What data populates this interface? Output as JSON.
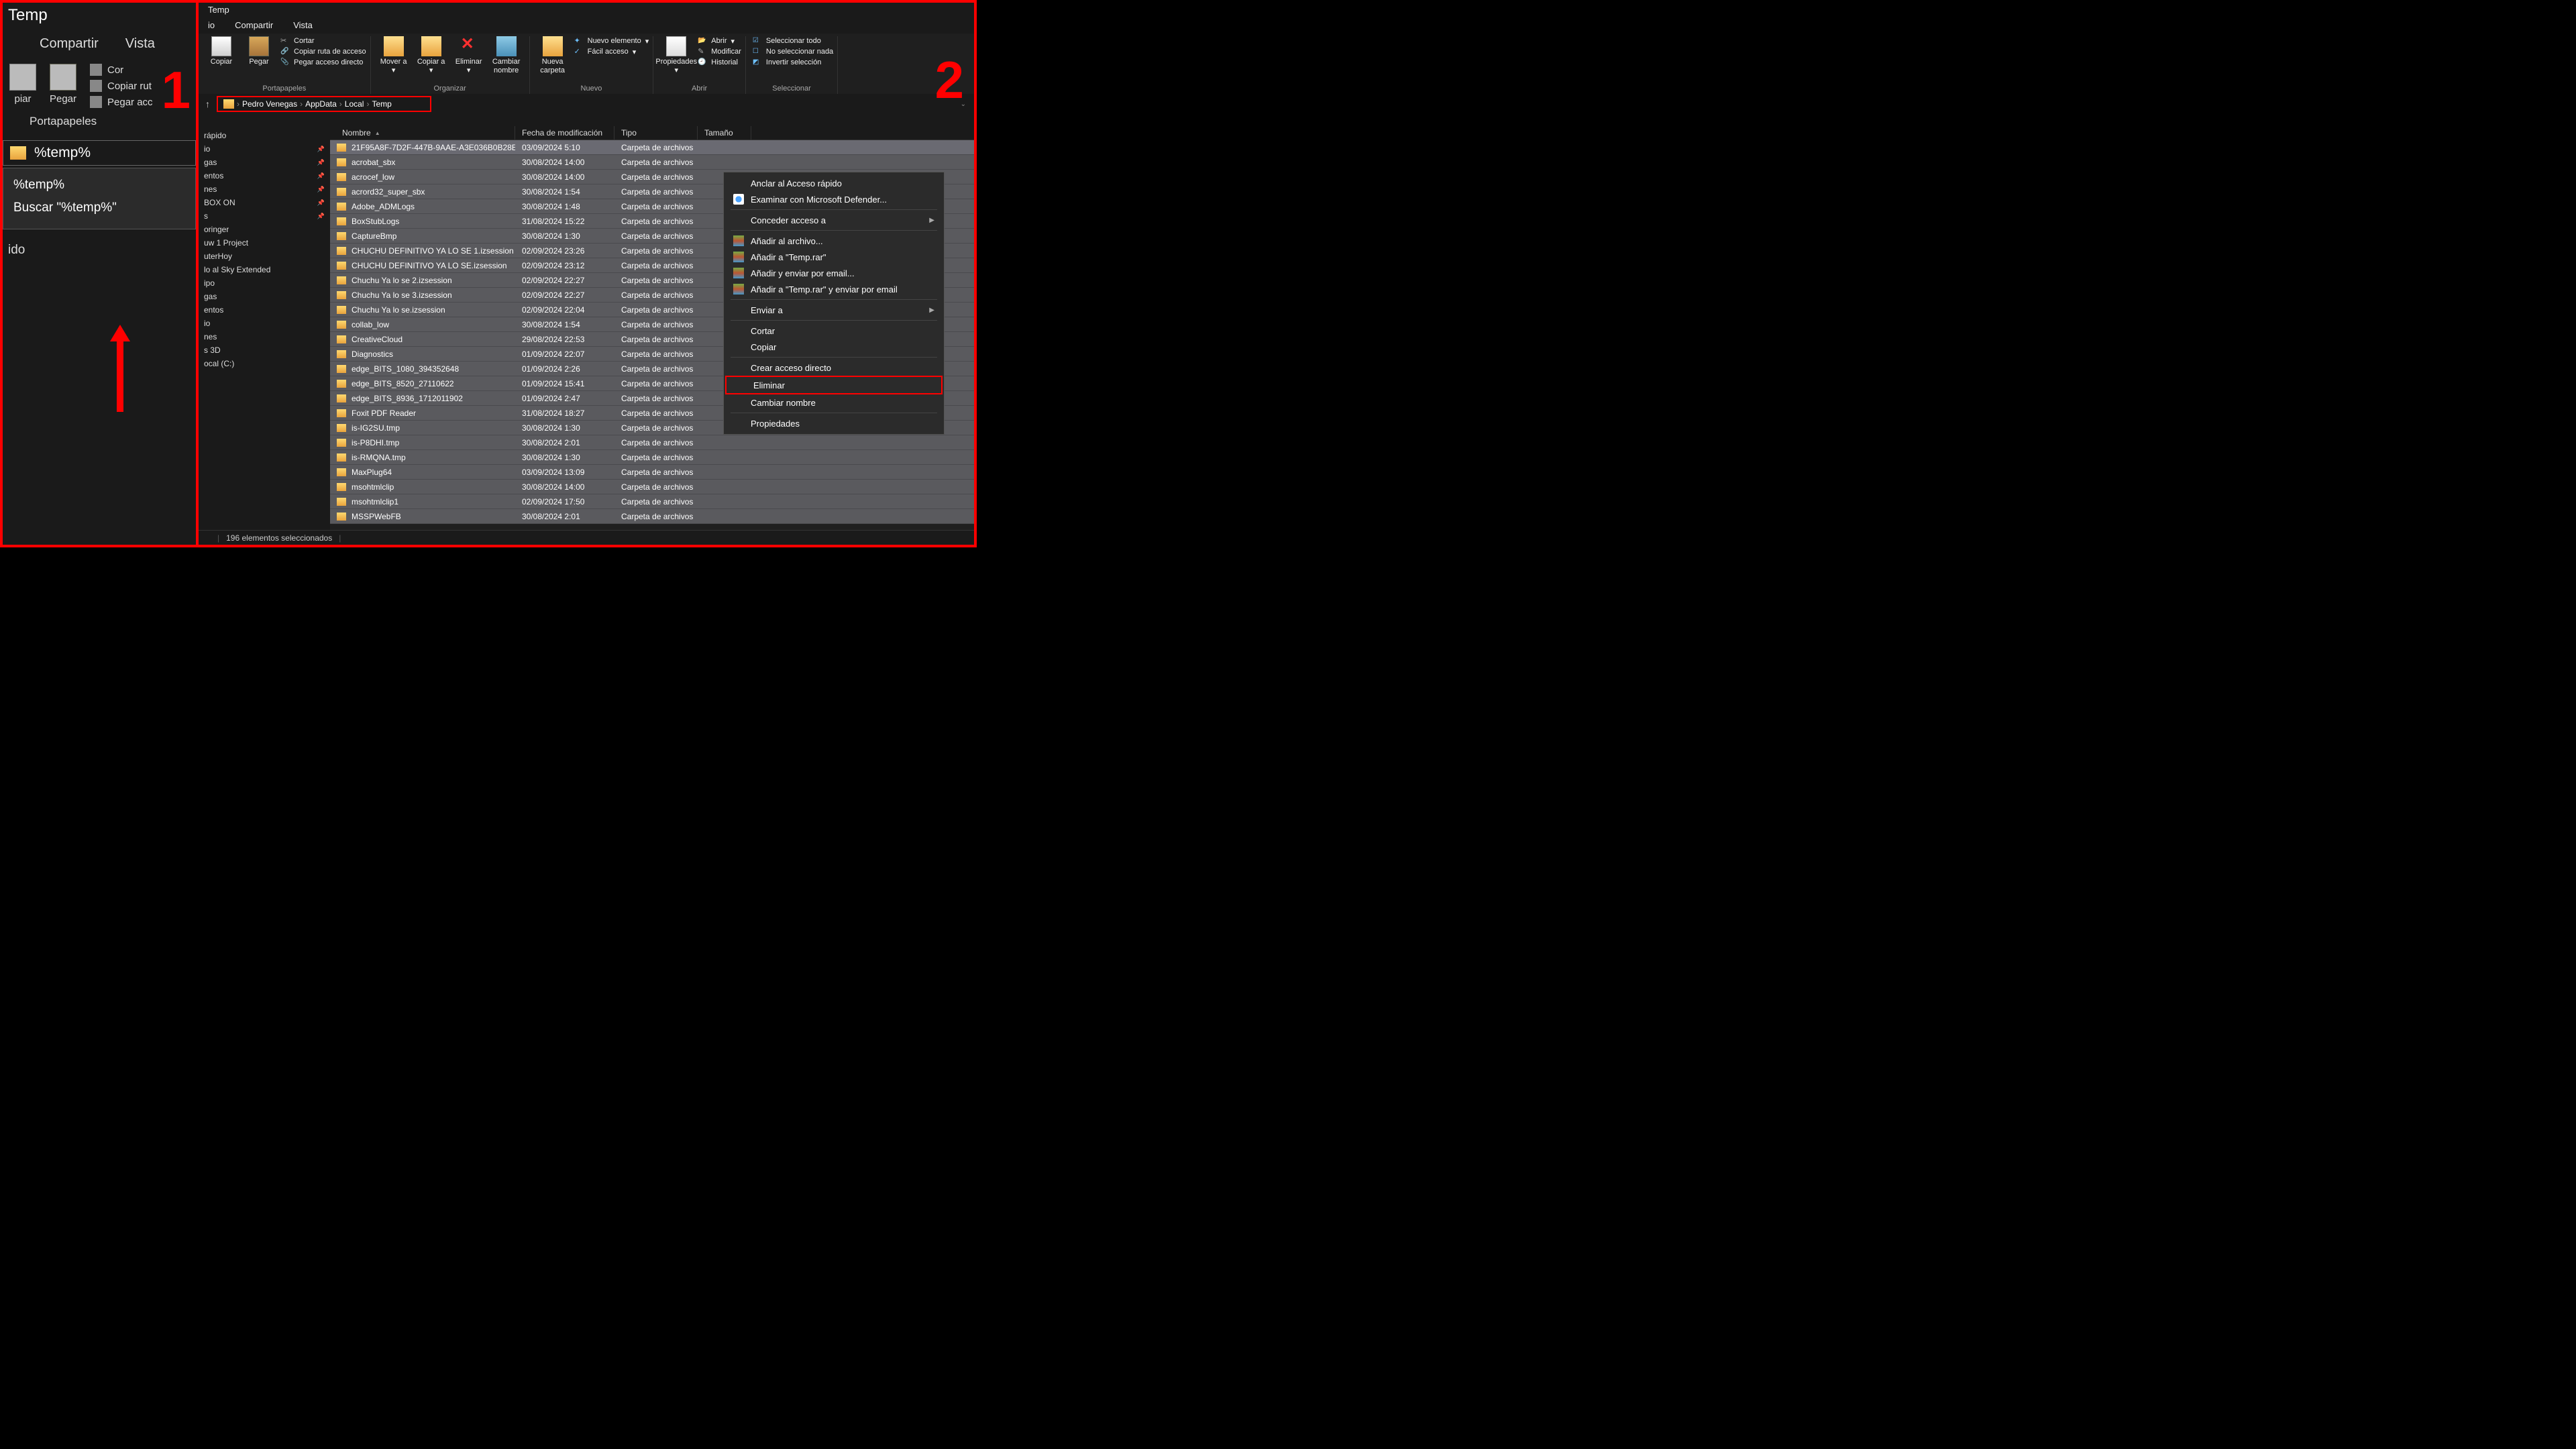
{
  "panel1": {
    "number": "1",
    "title": "Temp",
    "tabs": {
      "compartir": "Compartir",
      "vista": "Vista"
    },
    "big": {
      "copiar": "piar",
      "pegar": "Pegar"
    },
    "small": {
      "cortar": "Cor",
      "copiar_ruta": "Copiar rut",
      "pegar_acc": "Pegar acc"
    },
    "section": "Portapapeles",
    "addr_text": "%temp%",
    "drop1": "%temp%",
    "drop2": "Buscar \"%temp%\"",
    "side": "ido"
  },
  "panel2": {
    "number": "2",
    "title": "Temp",
    "tabs": {
      "inicio": "io",
      "compartir": "Compartir",
      "vista": "Vista"
    },
    "ribbon": {
      "portapapeles": {
        "copiar": "Copiar",
        "pegar": "Pegar",
        "cortar": "Cortar",
        "copiar_ruta": "Copiar ruta de acceso",
        "pegar_acc": "Pegar acceso directo",
        "label": "Portapapeles"
      },
      "organizar": {
        "mover": "Mover a",
        "copiar_a": "Copiar a",
        "eliminar": "Eliminar",
        "cambiar": "Cambiar nombre",
        "label": "Organizar"
      },
      "nuevo": {
        "carpeta": "Nueva carpeta",
        "nuevo_elem": "Nuevo elemento",
        "facil": "Fácil acceso",
        "label": "Nuevo"
      },
      "abrir": {
        "prop": "Propiedades",
        "abrir": "Abrir",
        "modificar": "Modificar",
        "historial": "Historial",
        "label": "Abrir"
      },
      "seleccionar": {
        "todo": "Seleccionar todo",
        "nada": "No seleccionar nada",
        "inv": "Invertir selección",
        "label": "Seleccionar"
      }
    },
    "breadcrumb": [
      "Pedro Venegas",
      "AppData",
      "Local",
      "Temp"
    ],
    "sidebar": [
      {
        "label": "rápido",
        "pin": false
      },
      {
        "label": "io",
        "pin": true
      },
      {
        "label": "gas",
        "pin": true
      },
      {
        "label": "entos",
        "pin": true
      },
      {
        "label": "nes",
        "pin": true
      },
      {
        "label": "BOX ON",
        "pin": true
      },
      {
        "label": "s",
        "pin": true
      },
      {
        "label": "oringer",
        "pin": false
      },
      {
        "label": "uw 1 Project",
        "pin": false
      },
      {
        "label": "uterHoy",
        "pin": false
      },
      {
        "label": "lo al Sky Extended",
        "pin": false
      },
      {
        "label": "ipo",
        "pin": false
      },
      {
        "label": "gas",
        "pin": false
      },
      {
        "label": "entos",
        "pin": false
      },
      {
        "label": "io",
        "pin": false
      },
      {
        "label": "nes",
        "pin": false
      },
      {
        "label": "s 3D",
        "pin": false
      },
      {
        "label": "ocal (C:)",
        "pin": false
      }
    ],
    "columns": {
      "name": "Nombre",
      "date": "Fecha de modificación",
      "type": "Tipo",
      "size": "Tamaño"
    },
    "files": [
      {
        "name": "21F95A8F-7D2F-447B-9AAE-A3E036B0B28E",
        "date": "03/09/2024 5:10",
        "type": "Carpeta de archivos"
      },
      {
        "name": "acrobat_sbx",
        "date": "30/08/2024 14:00",
        "type": "Carpeta de archivos"
      },
      {
        "name": "acrocef_low",
        "date": "30/08/2024 14:00",
        "type": "Carpeta de archivos"
      },
      {
        "name": "acrord32_super_sbx",
        "date": "30/08/2024 1:54",
        "type": "Carpeta de archivos"
      },
      {
        "name": "Adobe_ADMLogs",
        "date": "30/08/2024 1:48",
        "type": "Carpeta de archivos"
      },
      {
        "name": "BoxStubLogs",
        "date": "31/08/2024 15:22",
        "type": "Carpeta de archivos"
      },
      {
        "name": "CaptureBmp",
        "date": "30/08/2024 1:30",
        "type": "Carpeta de archivos"
      },
      {
        "name": "CHUCHU DEFINITIVO YA LO SE 1.izsession",
        "date": "02/09/2024 23:26",
        "type": "Carpeta de archivos"
      },
      {
        "name": "CHUCHU DEFINITIVO YA LO SE.izsession",
        "date": "02/09/2024 23:12",
        "type": "Carpeta de archivos"
      },
      {
        "name": "Chuchu Ya lo se 2.izsession",
        "date": "02/09/2024 22:27",
        "type": "Carpeta de archivos"
      },
      {
        "name": "Chuchu Ya lo se 3.izsession",
        "date": "02/09/2024 22:27",
        "type": "Carpeta de archivos"
      },
      {
        "name": "Chuchu Ya lo se.izsession",
        "date": "02/09/2024 22:04",
        "type": "Carpeta de archivos"
      },
      {
        "name": "collab_low",
        "date": "30/08/2024 1:54",
        "type": "Carpeta de archivos"
      },
      {
        "name": "CreativeCloud",
        "date": "29/08/2024 22:53",
        "type": "Carpeta de archivos"
      },
      {
        "name": "Diagnostics",
        "date": "01/09/2024 22:07",
        "type": "Carpeta de archivos"
      },
      {
        "name": "edge_BITS_1080_394352648",
        "date": "01/09/2024 2:26",
        "type": "Carpeta de archivos"
      },
      {
        "name": "edge_BITS_8520_27110622",
        "date": "01/09/2024 15:41",
        "type": "Carpeta de archivos"
      },
      {
        "name": "edge_BITS_8936_1712011902",
        "date": "01/09/2024 2:47",
        "type": "Carpeta de archivos"
      },
      {
        "name": "Foxit PDF Reader",
        "date": "31/08/2024 18:27",
        "type": "Carpeta de archivos"
      },
      {
        "name": "is-IG2SU.tmp",
        "date": "30/08/2024 1:30",
        "type": "Carpeta de archivos"
      },
      {
        "name": "is-P8DHI.tmp",
        "date": "30/08/2024 2:01",
        "type": "Carpeta de archivos"
      },
      {
        "name": "is-RMQNA.tmp",
        "date": "30/08/2024 1:30",
        "type": "Carpeta de archivos"
      },
      {
        "name": "MaxPlug64",
        "date": "03/09/2024 13:09",
        "type": "Carpeta de archivos"
      },
      {
        "name": "msohtmlclip",
        "date": "30/08/2024 14:00",
        "type": "Carpeta de archivos"
      },
      {
        "name": "msohtmlclip1",
        "date": "02/09/2024 17:50",
        "type": "Carpeta de archivos"
      },
      {
        "name": "MSSPWebFB",
        "date": "30/08/2024 2:01",
        "type": "Carpeta de archivos"
      }
    ],
    "status": "196 elementos seleccionados",
    "context": {
      "anclar": "Anclar al Acceso rápido",
      "defender": "Examinar con Microsoft Defender...",
      "conceder": "Conceder acceso a",
      "add_archivo": "Añadir al archivo...",
      "add_temp": "Añadir a \"Temp.rar\"",
      "enviar_email": "Añadir y enviar por email...",
      "add_temp_email": "Añadir a \"Temp.rar\" y enviar por email",
      "enviar_a": "Enviar a",
      "cortar": "Cortar",
      "copiar": "Copiar",
      "crear_acc": "Crear acceso directo",
      "eliminar": "Eliminar",
      "cambiar": "Cambiar nombre",
      "propiedades": "Propiedades"
    }
  }
}
